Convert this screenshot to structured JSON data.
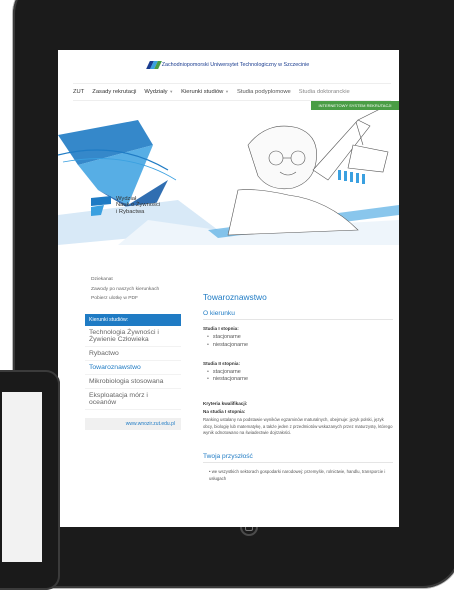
{
  "university": {
    "name": "Zachodniopomorski Uniwersytet Technologiczny w Szczecinie",
    "logo_colors": [
      "#1a3c8f",
      "#3aa0e0",
      "#4a9d45"
    ]
  },
  "nav": {
    "items": [
      {
        "label": "ZUT",
        "dropdown": false
      },
      {
        "label": "Zasady rekrutacji",
        "dropdown": false
      },
      {
        "label": "Wydziały",
        "dropdown": true
      },
      {
        "label": "Kierunki studiów",
        "dropdown": true
      },
      {
        "label": "Studia podyplomowe",
        "dropdown": false
      },
      {
        "label": "Studia doktoranckie",
        "dropdown": false
      }
    ]
  },
  "recruitment_button": "INTERNETOWY SYSTEM REKRUTACJI",
  "faculty": {
    "name_lines": [
      "Wydział",
      "Nauk o Żywności",
      "i Rybactwa"
    ]
  },
  "sidebar": {
    "links": [
      "Dziekanat",
      "Zawody po naszych kierunkach",
      "Pobierz ulotkę w PDF"
    ],
    "menu_header": "Kierunki studiów:",
    "items": [
      {
        "label": "Technologia Żywności i Żywienie Człowieka",
        "active": false
      },
      {
        "label": "Rybactwo",
        "active": false
      },
      {
        "label": "Towaroznawstwo",
        "active": true
      },
      {
        "label": "Mikrobiologia stosowana",
        "active": false
      },
      {
        "label": "Eksploatacja mórz i oceanów",
        "active": false
      }
    ],
    "url": "www.wnozir.zut.edu.pl"
  },
  "main": {
    "title": "Towaroznawstwo",
    "about_title": "O kierunku",
    "first_degree_label": "Studia I stopnia:",
    "first_degree_modes": [
      "stacjonarne",
      "niestacjonarne"
    ],
    "second_degree_label": "Studia II stopnia:",
    "second_degree_modes": [
      "stacjonarne",
      "niestacjonarne"
    ],
    "criteria_label": "Kryteria kwalifikacji:",
    "criteria_sub": "Na studia I stopnia:",
    "criteria_text": "Ranking ustalany na podstawie wyników egzaminów maturalnych, obejmuje: język polski, język obcy, biologię lub matematykę, a także jeden z przedmiotów wskazanych przez maturzystę, którego wynik odnotowano na świadectwie dojrzałości.",
    "future_title": "Twoja przyszłość",
    "future_bullet": "we wszystkich sektorach gospodarki narodowej: przemyśle, rolnictwie, handlu, transporcie i usługach"
  }
}
